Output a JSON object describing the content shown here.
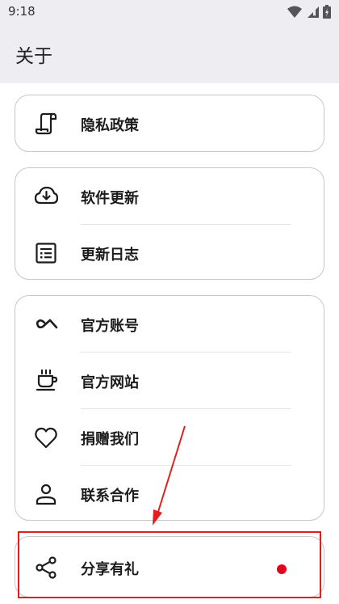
{
  "status_bar": {
    "time": "9:18",
    "icons": [
      "wifi-icon",
      "signal-icon",
      "battery-icon"
    ]
  },
  "app_bar": {
    "title": "关于"
  },
  "groups": [
    {
      "items": [
        {
          "label": "隐私政策",
          "icon": "scroll-icon"
        }
      ]
    },
    {
      "items": [
        {
          "label": "软件更新",
          "icon": "cloud-download-icon"
        },
        {
          "label": "更新日志",
          "icon": "list-alt-icon"
        }
      ]
    },
    {
      "items": [
        {
          "label": "官方账号",
          "icon": "infinity-icon"
        },
        {
          "label": "官方网站",
          "icon": "coffee-icon"
        },
        {
          "label": "捐赠我们",
          "icon": "heart-icon"
        },
        {
          "label": "联系合作",
          "icon": "person-icon"
        }
      ]
    },
    {
      "items": [
        {
          "label": "分享有礼",
          "icon": "share-icon",
          "badge": "red-dot"
        }
      ]
    }
  ],
  "colors": {
    "app_bar_bg": "#eeedf1",
    "card_border": "#c7c7cc",
    "badge": "#e8001c",
    "highlight": "#e02020"
  }
}
